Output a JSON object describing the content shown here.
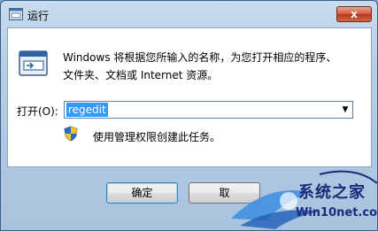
{
  "window": {
    "title": "运行",
    "close_glyph": "x"
  },
  "main": {
    "description_line1": "Windows 将根据您所输入的名称，为您打开相应的程序、",
    "description_line2": "文件夹、文档或 Internet 资源。",
    "open_label": "打开(O):",
    "open_value": "regedit",
    "admin_note": "使用管理权限创建此任务。"
  },
  "buttons": {
    "ok": "确定",
    "cancel": "取"
  },
  "watermark": {
    "brand": "系统之家",
    "url": "Win10net.com"
  },
  "colors": {
    "selection": "#3399ff",
    "close_red": "#c74426",
    "frame": "#b6cde6",
    "watermark_blue": "#1a2b7a"
  }
}
